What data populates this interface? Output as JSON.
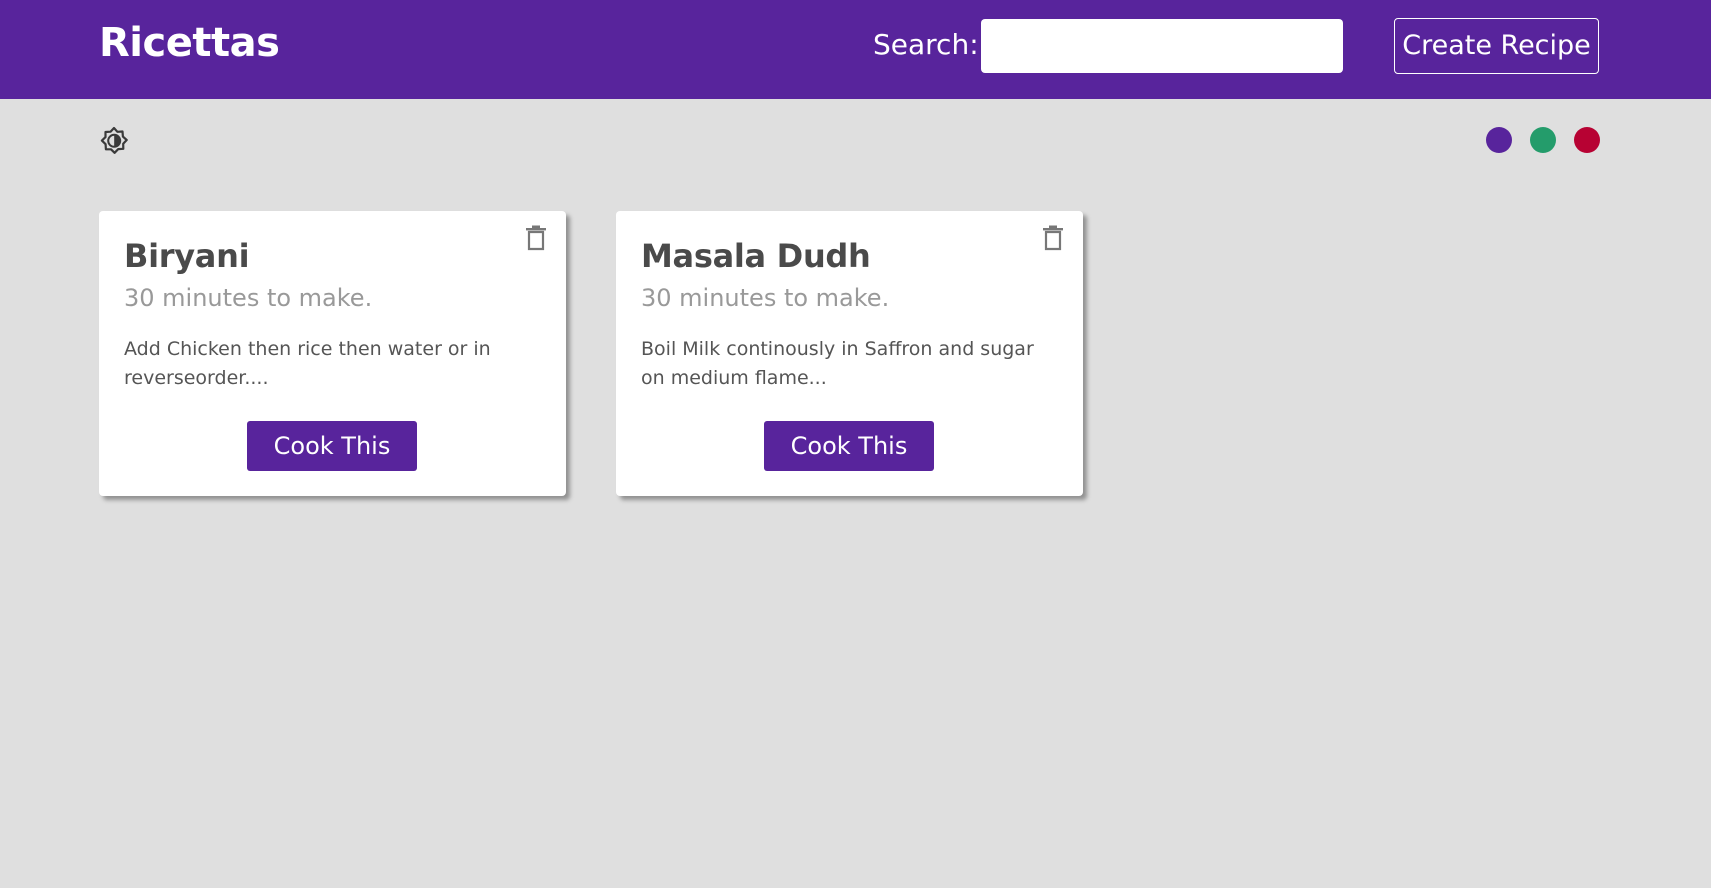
{
  "navbar": {
    "brand": "Ricettas",
    "search_label": "Search:",
    "search_value": "",
    "create_label": "Create Recipe",
    "background": "#58249c"
  },
  "toolbar": {
    "mode_toggle_icon": "brightness-contrast-icon",
    "theme_colors": [
      "#58249c",
      "#249c6b",
      "#b70233"
    ]
  },
  "recipes": [
    {
      "title": "Biryani",
      "time": "30 minutes to make.",
      "description": "Add Chicken then rice then water or in reverseorder....",
      "button_label": "Cook This",
      "delete_icon": "trash-icon"
    },
    {
      "title": "Masala Dudh",
      "time": "30 minutes to make.",
      "description": "Boil Milk continously in Saffron and sugar on medium flame...",
      "button_label": "Cook This",
      "delete_icon": "trash-icon"
    }
  ]
}
